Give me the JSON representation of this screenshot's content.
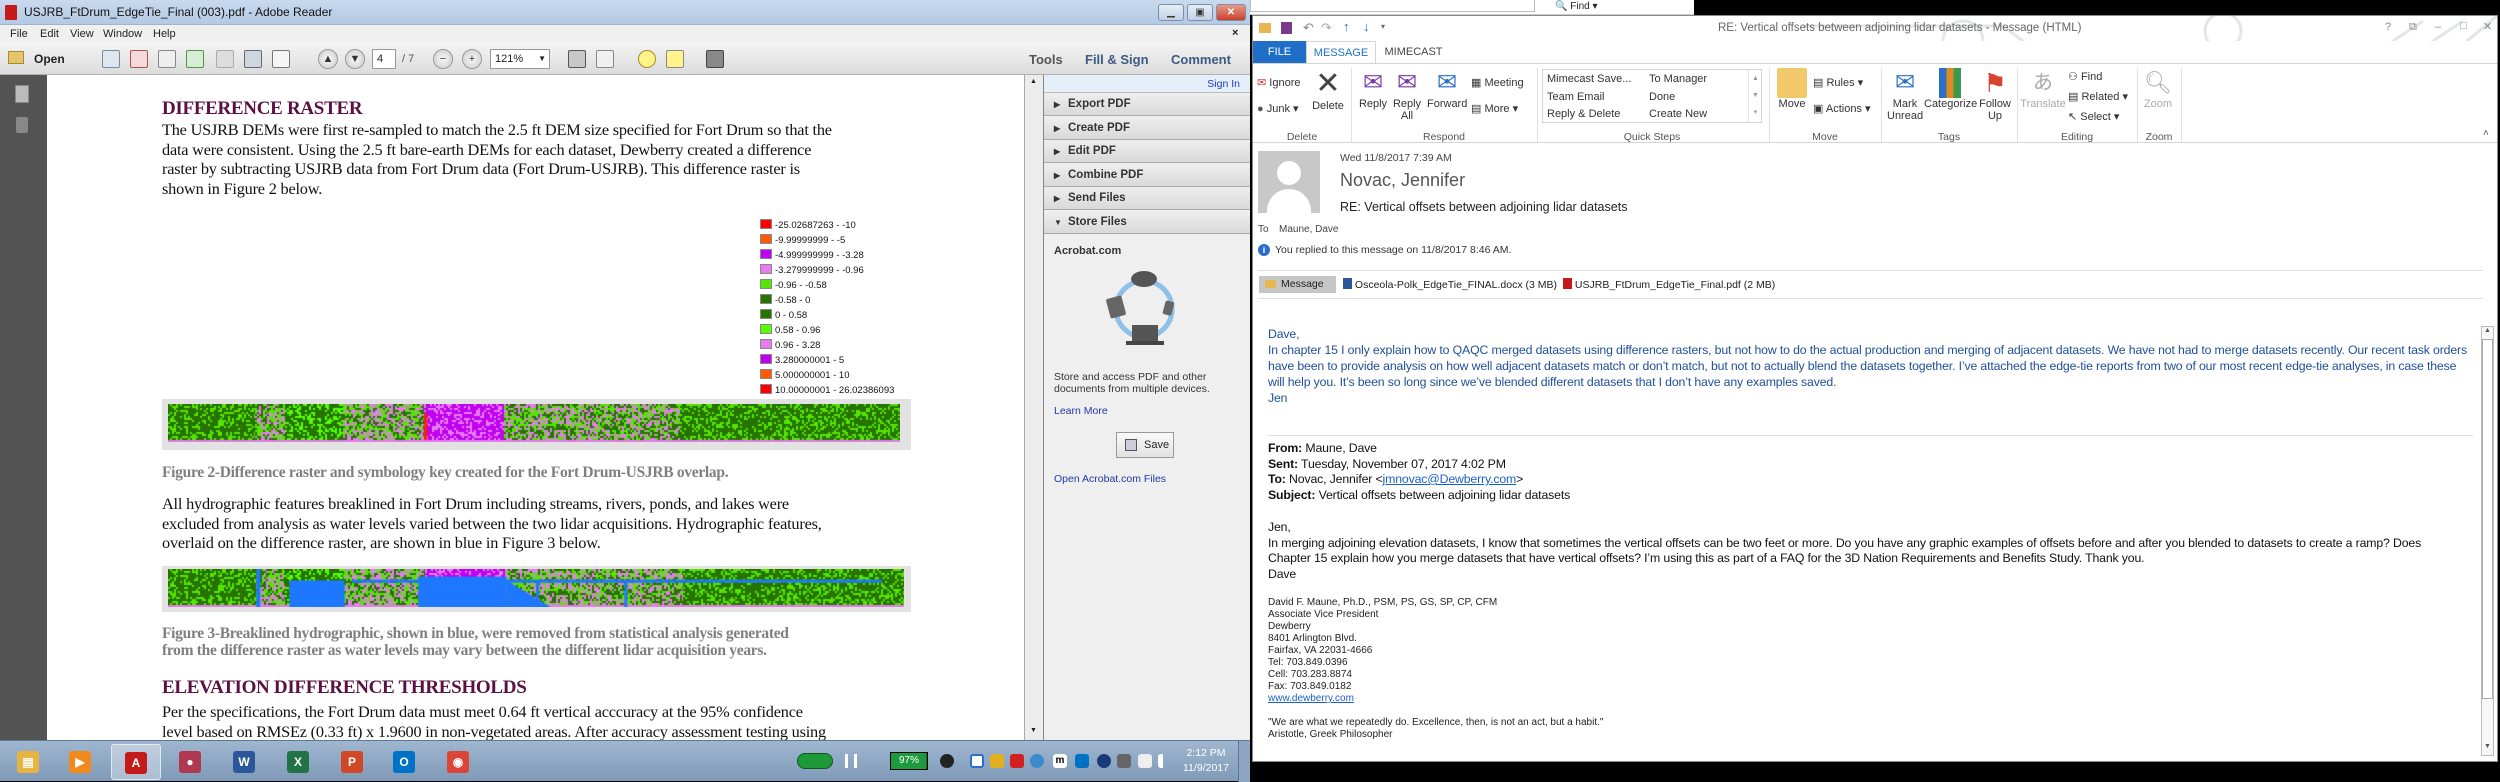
{
  "reader": {
    "title": "USJRB_FtDrum_EdgeTie_Final (003).pdf - Adobe Reader",
    "menu": [
      "File",
      "Edit",
      "View",
      "Window",
      "Help"
    ],
    "toolbar": {
      "open_label": "Open",
      "page_current": "4",
      "page_total": "/ 7",
      "zoom": "121%",
      "tools": "Tools",
      "fill_sign": "Fill & Sign",
      "comment": "Comment"
    },
    "panel": {
      "sign_in": "Sign In",
      "tools": [
        "Export PDF",
        "Create PDF",
        "Edit PDF",
        "Combine PDF",
        "Send Files",
        "Store Files"
      ],
      "acrobat_heading": "Acrobat.com",
      "description": [
        "Store and access PDF and other",
        "documents from multiple devices."
      ],
      "learn_more": "Learn More",
      "save_label": "Save",
      "open_files": "Open Acrobat.com Files"
    },
    "document": {
      "heading1": "DIFFERENCE RASTER",
      "para1": [
        "The USJRB DEMs were first re-sampled to match the 2.5 ft DEM size specified for Fort Drum so that the",
        "data were consistent.  Using the 2.5 ft bare-earth DEMs for each dataset, Dewberry created a difference",
        "raster by subtracting USJRB data from Fort Drum data (Fort Drum-USJRB).   This difference raster is",
        "shown in Figure 2  below."
      ],
      "legend": [
        {
          "label": "-25.02687263 - -10",
          "color": "#ff0000"
        },
        {
          "label": "-9.99999999 - -5",
          "color": "#ff5a00"
        },
        {
          "label": "-4.999999999 - -3.28",
          "color": "#c000f0"
        },
        {
          "label": "-3.279999999 - -0.96",
          "color": "#e67cf0"
        },
        {
          "label": "-0.96 - -0.58",
          "color": "#55e600"
        },
        {
          "label": "-0.58 - 0",
          "color": "#267300"
        },
        {
          "label": "0 - 0.58",
          "color": "#267300"
        },
        {
          "label": "0.58 - 0.96",
          "color": "#55ff00"
        },
        {
          "label": "0.96 - 3.28",
          "color": "#e67cf0"
        },
        {
          "label": "3.280000001 - 5",
          "color": "#c000f0"
        },
        {
          "label": "5.000000001 - 10",
          "color": "#ff5a00"
        },
        {
          "label": "10.00000001 - 26.02386093",
          "color": "#ff0000"
        }
      ],
      "caption2": "Figure 2-Difference raster and symbology key created for the Fort Drum-USJRB overlap.",
      "para2": [
        "All hydrographic features breaklined in Fort Drum including streams, rivers, ponds, and lakes were",
        "excluded from analysis as water levels varied between the two lidar acquisitions.  Hydrographic features,",
        "overlaid on the difference raster, are shown in blue in Figure 3 below."
      ],
      "caption3": [
        "Figure 3-Breaklined hydrographic, shown in blue, were removed from statistical analysis generated",
        "from the difference raster as water levels may vary between the different lidar acquisition years."
      ],
      "heading2": "ELEVATION DIFFERENCE THRESHOLDS",
      "para3": [
        "Per the specifications, the Fort Drum data must meet 0.64 ft vertical acccuracy at the 95% confidence",
        "level based on RMSEz (0.33 ft) x 1.9600 in non-vegetated areas.  After accuracy assessment testing using"
      ]
    }
  },
  "taskbar": {
    "apps": [
      {
        "name": "windows-explorer",
        "glyph": "▤",
        "color": "#e8b440"
      },
      {
        "name": "media-player",
        "glyph": "▶",
        "color": "#f08a1c"
      },
      {
        "name": "adobe-reader",
        "glyph": "A",
        "color": "#c41a1a"
      },
      {
        "name": "raspberry-app",
        "glyph": "●",
        "color": "#b03850"
      },
      {
        "name": "word",
        "glyph": "W",
        "color": "#2b579a"
      },
      {
        "name": "excel",
        "glyph": "X",
        "color": "#217346"
      },
      {
        "name": "powerpoint",
        "glyph": "P",
        "color": "#d24726"
      },
      {
        "name": "outlook",
        "glyph": "O",
        "color": "#0072c6"
      },
      {
        "name": "chrome",
        "glyph": "◉",
        "color": "#db4437"
      }
    ],
    "battery": "97%",
    "battery_level": 97,
    "time": "2:12 PM",
    "date": "11/9/2017"
  },
  "background_window": {
    "find_label": "Find"
  },
  "outlook": {
    "title": "RE: Vertical offsets between adjoining lidar datasets - Message (HTML)",
    "window_controls": [
      "?",
      "⧉",
      "–",
      "□",
      "✕"
    ],
    "tabs": [
      "FILE",
      "MESSAGE",
      "MIMECAST"
    ],
    "ribbon": {
      "delete": {
        "ignore": "Ignore",
        "junk": "Junk",
        "delete": "Delete",
        "group": "Delete"
      },
      "respond": {
        "reply": "Reply",
        "reply_all_1": "Reply",
        "reply_all_2": "All",
        "forward": "Forward",
        "meeting": "Meeting",
        "more": "More",
        "group": "Respond"
      },
      "quick_steps": {
        "items": [
          "Mimecast Save...",
          "To Manager",
          "Team Email",
          "Done",
          "Reply & Delete",
          "Create New"
        ],
        "group": "Quick Steps"
      },
      "move": {
        "move": "Move",
        "rules": "Rules",
        "actions": "Actions",
        "group": "Move"
      },
      "tags": {
        "mark_1": "Mark",
        "mark_2": "Unread",
        "categorize": "Categorize",
        "follow_1": "Follow",
        "follow_2": "Up",
        "group": "Tags"
      },
      "editing": {
        "translate": "Translate",
        "find": "Find",
        "related": "Related",
        "select": "Select",
        "group": "Editing"
      },
      "zoom": {
        "zoom": "Zoom",
        "group": "Zoom"
      }
    },
    "header": {
      "date": "Wed 11/8/2017 7:39 AM",
      "sender": "Novac, Jennifer",
      "subject": "RE: Vertical offsets between adjoining lidar datasets",
      "to_label": "To",
      "to": "Maune, Dave",
      "info": "You replied to this message on 11/8/2017 8:46 AM.",
      "message_tab": "Message",
      "attachments": [
        "Osceola-Polk_EdgeTie_FINAL.docx (3 MB)",
        "USJRB_FtDrum_EdgeTie_Final.pdf (2 MB)"
      ]
    },
    "body": {
      "reply_lines": [
        "Dave,",
        "In chapter 15 I only explain how to QAQC merged datasets using difference rasters, but not how to do the actual production and merging of adjacent datasets.  We have not had to merge datasets recently.  Our recent task orders",
        "have been to provide analysis on how well adjacent datasets match or don’t match, but not to actually blend the datasets together.  I’ve attached the edge-tie reports from two of our most recent edge-tie analyses, in case these",
        "will help you.  It’s been so long since we’ve blended different datasets that I don’t have any examples saved.",
        "Jen"
      ],
      "from_label": "From:",
      "from": " Maune, Dave",
      "sent_label": "Sent:",
      "sent": " Tuesday, November 07, 2017 4:02 PM",
      "to_label": "To:",
      "to": " Novac, Jennifer <",
      "to_email": "jmnovac@Dewberry.com",
      "to_end": ">",
      "subject_label": "Subject:",
      "subject": " Vertical offsets between adjoining lidar datasets",
      "original_lines": [
        "Jen,",
        "In merging adjoining elevation datasets, I know that sometimes the vertical offsets can be two feet or more.  Do you have any graphic examples of offsets before and after you blended to datasets to create a ramp? Does",
        "Chapter 15 explain how you merge datasets that have vertical offsets?  I’m using this as part of a FAQ for the 3D Nation Requirements and Benefits Study.  Thank you.",
        "Dave"
      ],
      "signature": [
        "David F. Maune, Ph.D., PSM, PS, GS, SP, CP, CFM",
        "Associate Vice President",
        "Dewberry",
        "8401 Arlington Blvd.",
        "Fairfax, VA 22031-4666",
        "Tel:  703.849.0396",
        "Cell: 703.283.8874",
        "Fax: 703.849.0182"
      ],
      "website": "www.dewberry.com",
      "quote": "\"We are what we repeatedly do.  Excellence, then, is not an act, but a habit.\"",
      "quote_author": "Aristotle, Greek Philosopher"
    }
  }
}
